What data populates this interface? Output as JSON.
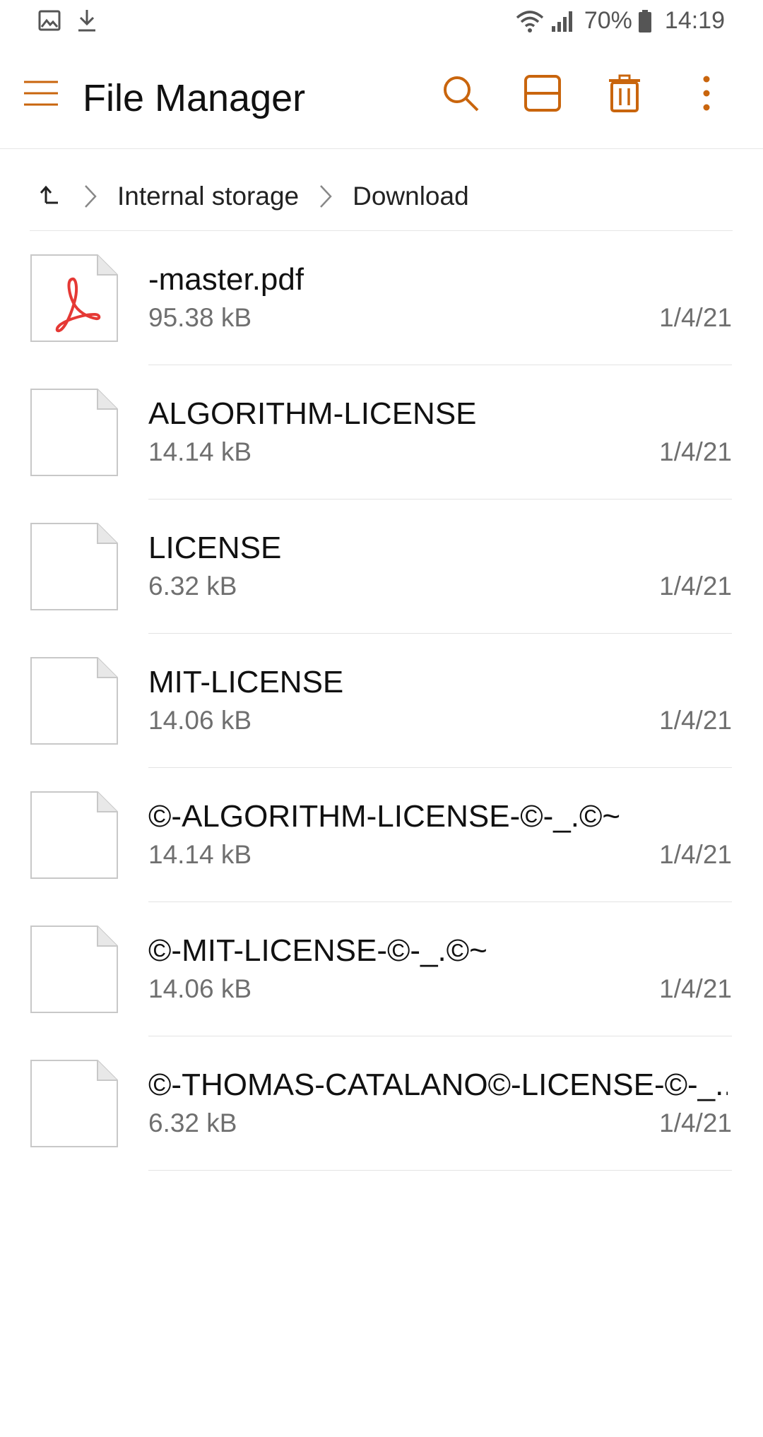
{
  "status_bar": {
    "left_icons": [
      "gallery-icon",
      "download-icon"
    ],
    "battery": "70%",
    "time": "14:19"
  },
  "app_bar": {
    "title": "File Manager",
    "actions": [
      "search-icon",
      "view-toggle-icon",
      "delete-icon",
      "more-options-icon"
    ],
    "accent_color": "#C9650D"
  },
  "breadcrumb": {
    "items": [
      "Internal storage",
      "Download"
    ]
  },
  "files": [
    {
      "name": "-master.pdf",
      "size": "95.38 kB",
      "date": "1/4/21",
      "icon": "pdf-file-icon"
    },
    {
      "name": "ALGORITHM-LICENSE",
      "size": "14.14 kB",
      "date": "1/4/21",
      "icon": "file-icon"
    },
    {
      "name": "LICENSE",
      "size": "6.32 kB",
      "date": "1/4/21",
      "icon": "file-icon"
    },
    {
      "name": "MIT-LICENSE",
      "size": "14.06 kB",
      "date": "1/4/21",
      "icon": "file-icon"
    },
    {
      "name": "©-ALGORITHM-LICENSE-©-_.©~",
      "size": "14.14 kB",
      "date": "1/4/21",
      "icon": "file-icon"
    },
    {
      "name": "©-MIT-LICENSE-©-_.©~",
      "size": "14.06 kB",
      "date": "1/4/21",
      "icon": "file-icon"
    },
    {
      "name": "©-THOMAS-CATALANO©-LICENSE-©-_..",
      "size": "6.32 kB",
      "date": "1/4/21",
      "icon": "file-icon"
    }
  ]
}
